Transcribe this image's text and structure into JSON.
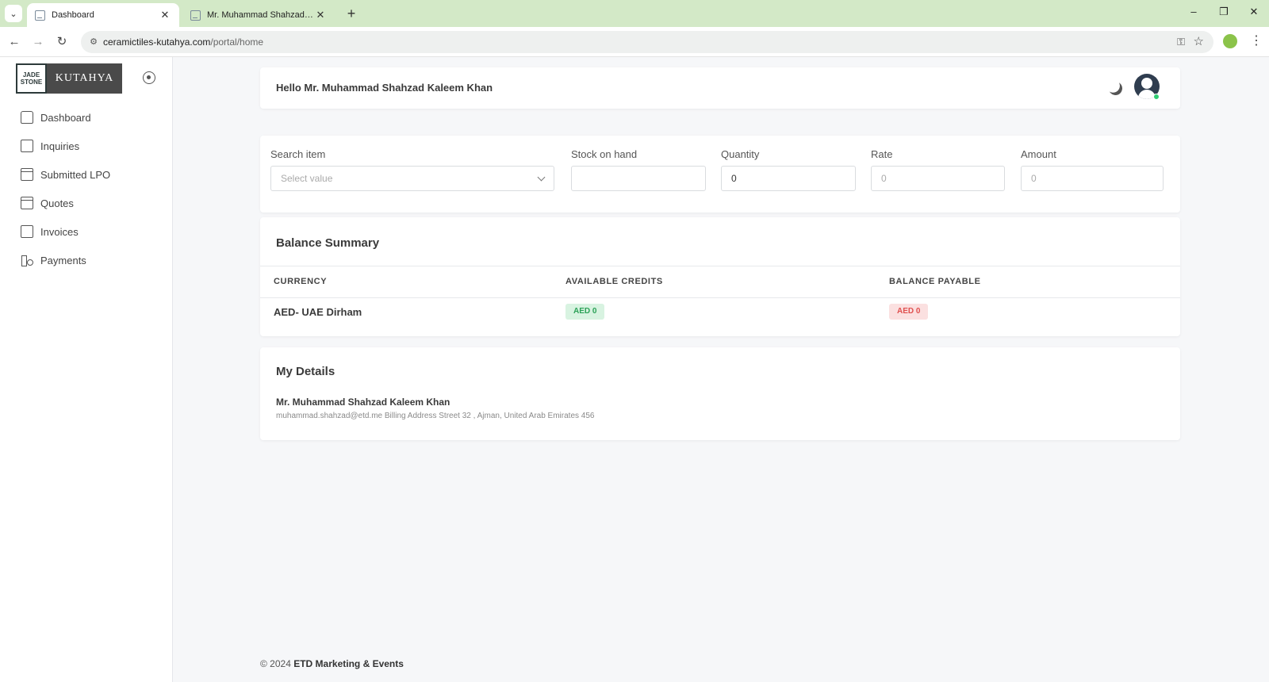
{
  "browser": {
    "tabs": [
      {
        "title": "Dashboard",
        "active": true
      },
      {
        "title": "Mr. Muhammad Shahzad Kaleem",
        "active": false
      }
    ],
    "url_host": "ceramictiles-kutahya.com",
    "url_path": "/portal/home"
  },
  "sidebar": {
    "logo_left_line1": "JADE",
    "logo_left_line2": "STONE",
    "logo_right": "KUTAHYA",
    "items": [
      {
        "label": "Dashboard",
        "icon": "home-icon"
      },
      {
        "label": "Inquiries",
        "icon": "inquiry-icon"
      },
      {
        "label": "Submitted LPO",
        "icon": "calendar-icon"
      },
      {
        "label": "Quotes",
        "icon": "calendar-icon"
      },
      {
        "label": "Invoices",
        "icon": "invoice-icon"
      },
      {
        "label": "Payments",
        "icon": "payments-icon"
      }
    ]
  },
  "header": {
    "greeting": "Hello Mr. Muhammad Shahzad Kaleem Khan"
  },
  "search": {
    "search_label": "Search item",
    "search_placeholder": "Select value",
    "stock_label": "Stock on hand",
    "stock_value": "",
    "quantity_label": "Quantity",
    "quantity_value": "0",
    "rate_label": "Rate",
    "rate_value": "0",
    "amount_label": "Amount",
    "amount_value": "0"
  },
  "balance": {
    "title": "Balance Summary",
    "columns": [
      "CURRENCY",
      "AVAILABLE CREDITS",
      "BALANCE PAYABLE"
    ],
    "rows": [
      {
        "currency": "AED- UAE Dirham",
        "credits": "AED 0",
        "payable": "AED 0"
      }
    ],
    "credit_color": "#2ba157",
    "payable_color": "#e0504f"
  },
  "details": {
    "title": "My Details",
    "name": "Mr. Muhammad Shahzad Kaleem Khan",
    "info": "muhammad.shahzad@etd.me Billing Address Street 32 , Ajman, United Arab Emirates 456"
  },
  "footer": {
    "prefix": "© 2024",
    "company": "ETD Marketing & Events"
  }
}
